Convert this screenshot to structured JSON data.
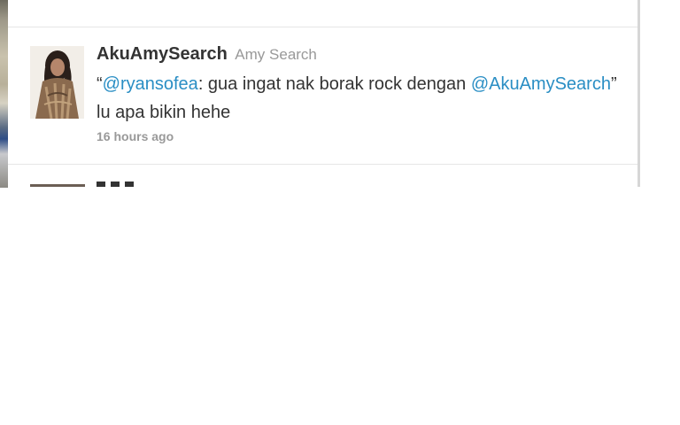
{
  "tweet": {
    "screen_name": "AkuAmySearch",
    "full_name": "Amy Search",
    "text": {
      "open_quote": "“",
      "mention1": "@ryansofea",
      "part1": ": gua ingat nak borak rock dengan ",
      "mention2": "@AkuAmySearch",
      "part2": "” lu apa bikin hehe"
    },
    "timestamp": "16 hours ago",
    "colors": {
      "link": "#2a8ec4",
      "text": "#333333",
      "muted": "#999999"
    }
  }
}
